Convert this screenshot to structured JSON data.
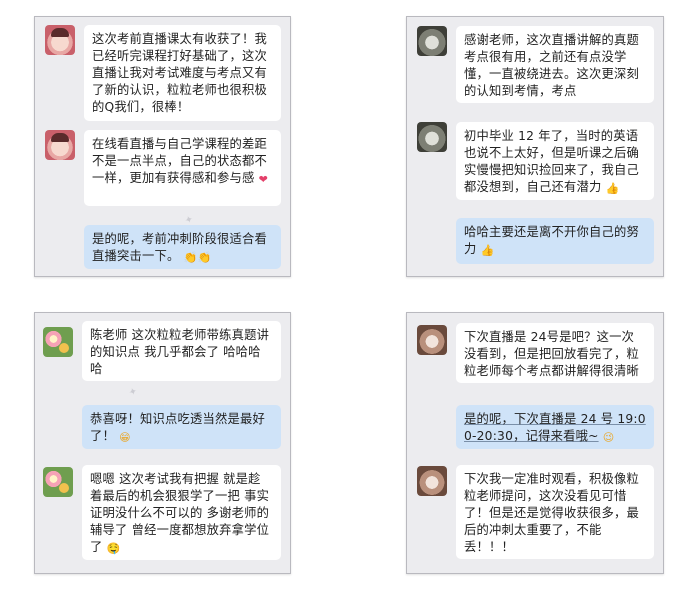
{
  "panels": [
    {
      "messages": [
        {
          "text": "这次考前直播课太有收获了！我已经听完课程打好基础了，这次直播让我对考试难度与考点又有了新的认识，粒粒老师也很积极的Q我们，很棒！"
        },
        {
          "text": "在线看直播与自己学课程的差距不是一点半点，自己的状态都不一样，更加有获得感和参与感",
          "emoji": "❤"
        },
        {
          "text": "是的呢，考前冲刺阶段很适合看直播突击一下。",
          "emoji": "👏👏"
        }
      ]
    },
    {
      "messages": [
        {
          "text": "感谢老师，这次直播讲解的真题考点很有用，之前还有点没学懂，一直被绕进去。这次更深刻的认知到考情，考点"
        },
        {
          "text": "初中毕业 12 年了，当时的英语也说不上太好，但是听课之后确实慢慢把知识捡回来了，我自己都没想到，自己还有潜力",
          "emoji": "👍"
        },
        {
          "text": "哈哈主要还是离不开你自己的努力",
          "emoji": "👍"
        }
      ]
    },
    {
      "messages": [
        {
          "text": "陈老师  这次粒粒老师带练真题讲的知识点  我几乎都会了  哈哈哈哈"
        },
        {
          "text": "恭喜呀！知识点吃透当然是最好了！",
          "emoji": "😁"
        },
        {
          "text": "嗯嗯 这次考试我有把握 就是趁着最后的机会狠狠学了一把  事实证明没什么不可以的  多谢老师的辅导了 曾经一度都想放弃拿学位了",
          "emoji": "🤤"
        }
      ]
    },
    {
      "messages": [
        {
          "text": "下次直播是 24号是吧？这一次没看到，但是把回放看完了，粒粒老师每个考点都讲解得很清晰"
        },
        {
          "text": "是的呢，下次直播是 24 号 19:00-20:30，记得来看哦~",
          "emoji": "😉"
        },
        {
          "text": "下次我一定准时观看，积极像粒粒老师提问，这次没看见可惜了！但是还是觉得收获很多，最后的冲刺太重要了，不能丢！！！"
        }
      ]
    }
  ],
  "icons": {
    "avatar_1": "girl-avatar-icon",
    "avatar_2": "portrait-avatar-icon",
    "avatar_3": "flower-avatar-icon",
    "avatar_4": "portrait-avatar-icon"
  },
  "colors": {
    "panel_bg": "#ececef",
    "incoming_bubble": "#ffffff",
    "outgoing_bubble": "#cfe3f8"
  }
}
